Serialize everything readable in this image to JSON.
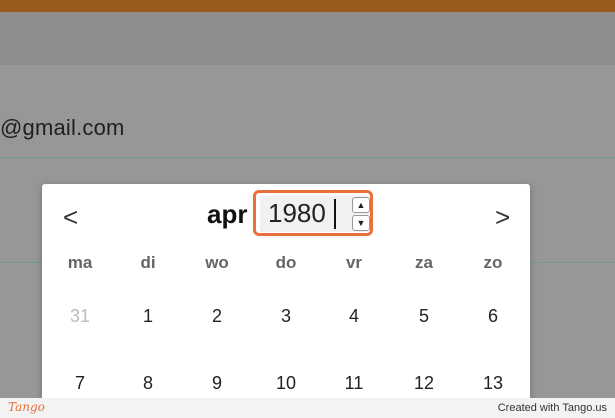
{
  "form": {
    "email_value": "@gmail.com"
  },
  "datepicker": {
    "prev_icon": "chevron-left-icon",
    "next_icon": "chevron-right-icon",
    "prev_glyph": "<",
    "next_glyph": ">",
    "month": "apr",
    "year": "1980",
    "spin_up_glyph": "▲",
    "spin_down_glyph": "▼",
    "weekdays": [
      "ma",
      "di",
      "wo",
      "do",
      "vr",
      "za",
      "zo"
    ],
    "weeks": [
      [
        "31",
        "1",
        "2",
        "3",
        "4",
        "5",
        "6"
      ],
      [
        "7",
        "8",
        "9",
        "10",
        "11",
        "12",
        "13"
      ]
    ]
  },
  "footer": {
    "brand": "Tango",
    "credit": "Created with Tango.us"
  },
  "colors": {
    "accent": "#e8703a",
    "topbar": "#9a5a1c"
  }
}
